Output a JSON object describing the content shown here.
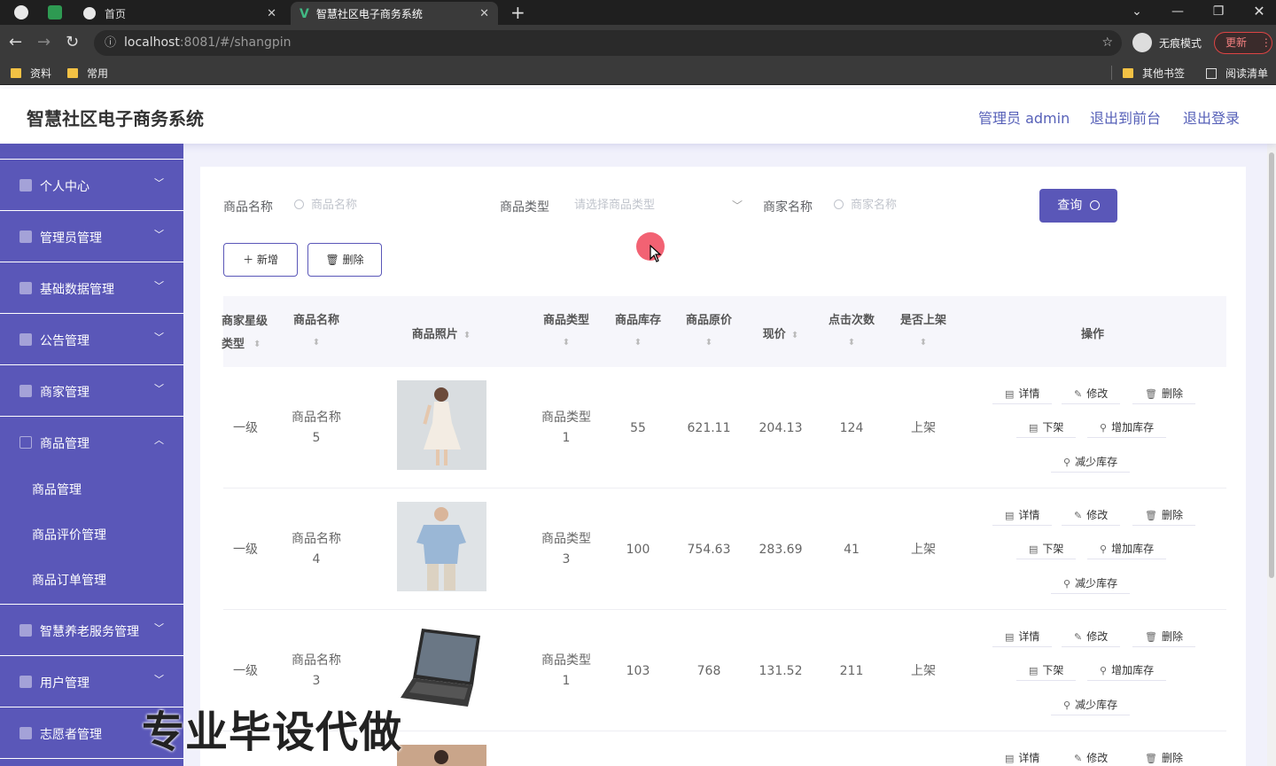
{
  "browser": {
    "tabs": [
      {
        "title": "首页"
      },
      {
        "title": "智慧社区电子商务系统"
      }
    ],
    "url_host": "localhost",
    "url_rest": ":8081/#/shangpin",
    "incognito_label": "无痕模式",
    "update_label": "更新",
    "bookmarks": [
      "资料",
      "常用"
    ],
    "bookmarks_right": [
      "其他书签",
      "阅读清单"
    ]
  },
  "header": {
    "title": "智慧社区电子商务系统",
    "admin": "管理员 admin",
    "to_front": "退出到前台",
    "logout": "退出登录"
  },
  "sidebar": {
    "items": [
      {
        "label": "个人中心"
      },
      {
        "label": "管理员管理"
      },
      {
        "label": "基础数据管理"
      },
      {
        "label": "公告管理"
      },
      {
        "label": "商家管理"
      },
      {
        "label": "商品管理"
      },
      {
        "label": "智慧养老服务管理"
      },
      {
        "label": "用户管理"
      },
      {
        "label": "志愿者管理"
      }
    ],
    "sub_items": [
      "商品管理",
      "商品评价管理",
      "商品订单管理"
    ]
  },
  "filters": {
    "name_label": "商品名称",
    "name_placeholder": "商品名称",
    "type_label": "商品类型",
    "type_placeholder": "请选择商品类型",
    "merchant_label": "商家名称",
    "merchant_placeholder": "商家名称",
    "query_label": "查询"
  },
  "toolbar": {
    "add_label": "新增",
    "delete_label": "删除"
  },
  "table": {
    "headers": {
      "star": "商家星级类型",
      "name": "商品名称",
      "photo": "商品照片",
      "type": "商品类型",
      "stock": "商品库存",
      "orig_price": "商品原价",
      "price": "现价",
      "clicks": "点击次数",
      "on_shelf": "是否上架",
      "ops": "操作"
    },
    "rows": [
      {
        "star": "一级",
        "name_a": "商品名称",
        "name_b": "5",
        "photo": "dress-photo",
        "type_a": "商品类型",
        "type_b": "1",
        "stock": "55",
        "orig_price": "621.11",
        "price": "204.13",
        "clicks": "124",
        "on_shelf": "上架"
      },
      {
        "star": "一级",
        "name_a": "商品名称",
        "name_b": "4",
        "photo": "polo-shirt-photo",
        "type_a": "商品类型",
        "type_b": "3",
        "stock": "100",
        "orig_price": "754.63",
        "price": "283.69",
        "clicks": "41",
        "on_shelf": "上架"
      },
      {
        "star": "一级",
        "name_a": "商品名称",
        "name_b": "3",
        "photo": "laptop-photo",
        "type_a": "商品类型",
        "type_b": "1",
        "stock": "103",
        "orig_price": "768",
        "price": "131.52",
        "clicks": "211",
        "on_shelf": "上架"
      }
    ],
    "actions": {
      "detail": "详情",
      "edit": "修改",
      "delete": "删除",
      "off_shelf": "下架",
      "add_stock": "增加库存",
      "reduce_stock": "减少库存"
    }
  },
  "watermark": "专业毕设代做",
  "colors": {
    "accent": "#5a57b8",
    "content_bg": "#f1f1fb",
    "header_link": "#5660b8"
  }
}
